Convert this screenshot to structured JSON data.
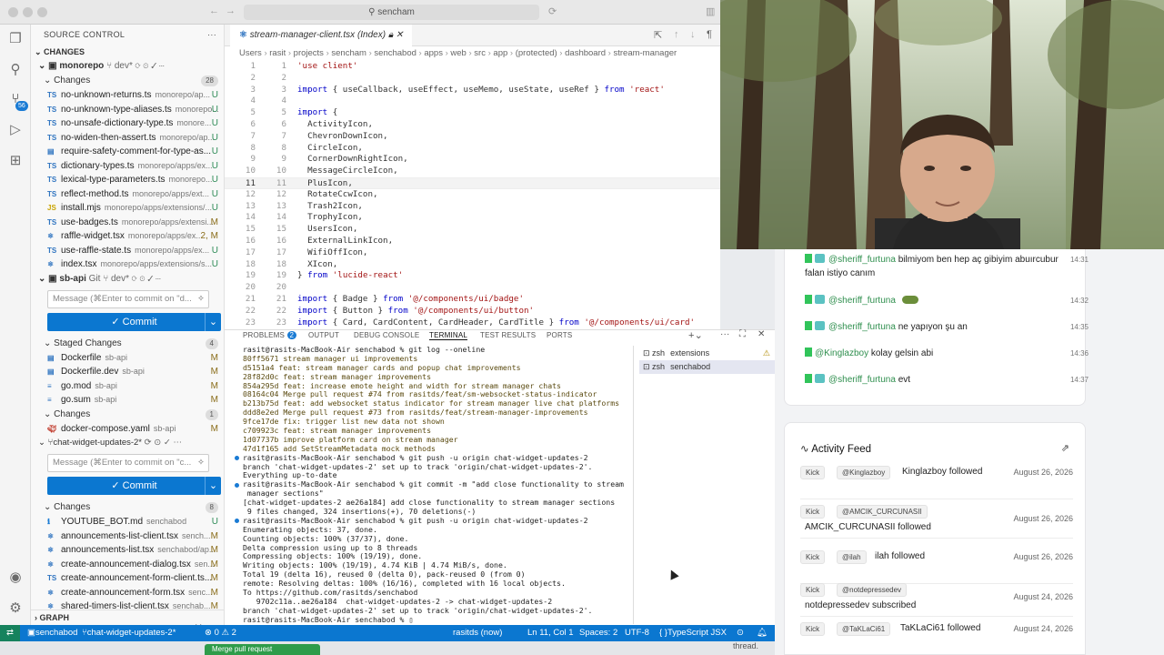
{
  "titlebar": {
    "search": "sencham"
  },
  "activitybar": {
    "scm_badge": "56"
  },
  "sidebar": {
    "title": "SOURCE CONTROL",
    "changes_header": "CHANGES",
    "repo1": {
      "name": "monorepo",
      "branch": "dev*"
    },
    "repo1_changes_label": "Changes",
    "repo1_changes_count": "28",
    "repo1_files": [
      {
        "name": "no-unknown-returns.ts",
        "dir": "monorepo/ap...",
        "status": "U"
      },
      {
        "name": "no-unknown-type-aliases.ts",
        "dir": "monorepo...",
        "status": "U"
      },
      {
        "name": "no-unsafe-dictionary-type.ts",
        "dir": "monore...",
        "status": "U"
      },
      {
        "name": "no-widen-then-assert.ts",
        "dir": "monorepo/ap...",
        "status": "U"
      },
      {
        "name": "require-safety-comment-for-type-as...",
        "dir": "",
        "status": "U"
      },
      {
        "name": "dictionary-types.ts",
        "dir": "monorepo/apps/ex...",
        "status": "U"
      },
      {
        "name": "lexical-type-parameters.ts",
        "dir": "monorepo...",
        "status": "U"
      },
      {
        "name": "reflect-method.ts",
        "dir": "monorepo/apps/ext...",
        "status": "U"
      },
      {
        "name": "install.mjs",
        "dir": "monorepo/apps/extensions/...",
        "status": "U"
      },
      {
        "name": "use-badges.ts",
        "dir": "monorepo/apps/extensi...",
        "status": "M"
      },
      {
        "name": "raffle-widget.tsx",
        "dir": "monorepo/apps/ex...",
        "status": "2, M"
      },
      {
        "name": "use-raffle-state.ts",
        "dir": "monorepo/apps/ex...",
        "status": "U"
      },
      {
        "name": "index.tsx",
        "dir": "monorepo/apps/extensions/s...",
        "status": "U"
      }
    ],
    "repo2": {
      "name": "sb-api",
      "vcs": "Git",
      "branch": "dev*"
    },
    "repo2_msg_placeholder": "Message (⌘Enter to commit on \"d...",
    "commit_label": "✓ Commit",
    "staged_label": "Staged Changes",
    "staged_count": "4",
    "staged_files": [
      {
        "name": "Dockerfile",
        "dir": "sb-api",
        "status": "M"
      },
      {
        "name": "Dockerfile.dev",
        "dir": "sb-api",
        "status": "M"
      },
      {
        "name": "go.mod",
        "dir": "sb-api",
        "status": "M"
      },
      {
        "name": "go.sum",
        "dir": "sb-api",
        "status": "M"
      }
    ],
    "repo2_changes_label": "Changes",
    "repo2_changes_count": "1",
    "repo2_files": [
      {
        "name": "docker-compose.yaml",
        "dir": "sb-api",
        "status": "M"
      }
    ],
    "repo3": {
      "branch": "chat-widget-updates-2*"
    },
    "repo3_msg_placeholder": "Message (⌘Enter to commit on \"c...",
    "repo3_changes_label": "Changes",
    "repo3_changes_count": "8",
    "repo3_files": [
      {
        "name": "YOUTUBE_BOT.md",
        "dir": "senchabod",
        "status": "U"
      },
      {
        "name": "announcements-list-client.tsx",
        "dir": "sench...",
        "status": "M"
      },
      {
        "name": "announcements-list.tsx",
        "dir": "senchabod/ap...",
        "status": "M"
      },
      {
        "name": "create-announcement-dialog.tsx",
        "dir": "sen...",
        "status": "M"
      },
      {
        "name": "create-announcement-form-client.ts...",
        "dir": "",
        "status": "M"
      },
      {
        "name": "create-announcement-form.tsx",
        "dir": "senc...",
        "status": "M"
      },
      {
        "name": "shared-timers-list-client.tsx",
        "dir": "senchab...",
        "status": "M"
      },
      {
        "name": "shared-timers-list.tsx",
        "dir": "senchabod/app...",
        "status": "M"
      }
    ],
    "graph_label": "GRAPH"
  },
  "editor": {
    "tab": "stream-manager-client.tsx (Index)",
    "breadcrumb": [
      "Users",
      "rasit",
      "projects",
      "sencham",
      "senchabod",
      "apps",
      "web",
      "src",
      "app",
      "(protected)",
      "dashboard",
      "stream-manager"
    ],
    "lines": [
      "'use client'",
      "",
      "import { useCallback, useEffect, useMemo, useState, useRef } from 'react'",
      "",
      "import {",
      "  ActivityIcon,",
      "  ChevronDownIcon,",
      "  CircleIcon,",
      "  CornerDownRightIcon,",
      "  MessageCircleIcon,",
      "  PlusIcon,",
      "  RotateCcwIcon,",
      "  Trash2Icon,",
      "  TrophyIcon,",
      "  UsersIcon,",
      "  ExternalLinkIcon,",
      "  WifiOffIcon,",
      "  XIcon,",
      "} from 'lucide-react'",
      "",
      "import { Badge } from '@/components/ui/badge'",
      "import { Button } from '@/components/ui/button'",
      "import { Card, CardContent, CardHeader, CardTitle } from '@/components/ui/card'"
    ]
  },
  "panel": {
    "tabs": {
      "problems": "PROBLEMS",
      "problems_count": "2",
      "output": "OUTPUT",
      "debug": "DEBUG CONSOLE",
      "terminal": "TERMINAL",
      "test": "TEST RESULTS",
      "ports": "PORTS"
    },
    "terminal_lines": [
      "rasit@rasits-MacBook-Air senchabod % git log --oneline",
      "80ff5671 stream manager ui improvements",
      "d5151a4 feat: stream manager cards and popup chat improvements",
      "28f82d0c feat: stream manager improvements",
      "854a295d feat: increase emote height and width for stream manager chats",
      "08164c04 Merge pull request #74 from rasitds/feat/sm-websocket-status-indicator",
      "b213b75d feat: add websocket status indicator for stream manager live chat platforms",
      "ddd8e2ed Merge pull request #73 from rasitds/feat/stream-manager-improvements",
      "9fce17de fix: trigger list new data not shown",
      "c709923c feat: stream manager improvements",
      "1d07737b improve platform card on stream manager",
      "47d1f165 add SetStreamMetadata mock methods",
      "rasit@rasits-MacBook-Air senchabod % git push -u origin chat-widget-updates-2",
      "branch 'chat-widget-updates-2' set up to track 'origin/chat-widget-updates-2'.",
      "Everything up-to-date",
      "rasit@rasits-MacBook-Air senchabod % git commit -m \"add close functionality to stream",
      " manager sections\"",
      "[chat-widget-updates-2 ae26a184] add close functionality to stream manager sections",
      " 9 files changed, 324 insertions(+), 70 deletions(-)",
      "rasit@rasits-MacBook-Air senchabod % git push -u origin chat-widget-updates-2",
      "Enumerating objects: 37, done.",
      "Counting objects: 100% (37/37), done.",
      "Delta compression using up to 8 threads",
      "Compressing objects: 100% (19/19), done.",
      "Writing objects: 100% (19/19), 4.74 KiB | 4.74 MiB/s, done.",
      "Total 19 (delta 16), reused 0 (delta 0), pack-reused 0 (from 0)",
      "remote: Resolving deltas: 100% (16/16), completed with 16 local objects.",
      "To https://github.com/rasitds/senchabod",
      "   9702c11a..ae26a184  chat-widget-updates-2 -> chat-widget-updates-2",
      "branch 'chat-widget-updates-2' set up to track 'origin/chat-widget-updates-2'.",
      "rasit@rasits-MacBook-Air senchabod % "
    ],
    "term_list": [
      {
        "shell": "zsh",
        "name": "extensions"
      },
      {
        "shell": "zsh",
        "name": "senchabod"
      }
    ]
  },
  "statusbar": {
    "repo": "senchabod",
    "branch": "chat-widget-updates-2*",
    "problems": "⊗ 0 ⚠ 2",
    "author": "rasitds (now)",
    "position": "Ln 11, Col 1",
    "spaces": "Spaces: 2",
    "encoding": "UTF-8",
    "language": "TypeScript JSX"
  },
  "chat": [
    {
      "user": "@sheriff_furtuna",
      "text": "bilmiyom ben hep aç gibiyim abuırcubur falan istiyo canım",
      "time": "14:31",
      "emote": true
    },
    {
      "user": "@sheriff_furtuna",
      "text": "",
      "time": "14:32",
      "emote": true,
      "sticker": true
    },
    {
      "user": "@sheriff_furtuna",
      "text": "ne yapıyon şu an",
      "time": "14:35",
      "emote": true
    },
    {
      "user": "@Kinglazboy",
      "text": "kolay gelsin abi",
      "time": "14:36",
      "emote": false
    },
    {
      "user": "@sheriff_furtuna",
      "text": "evt",
      "time": "14:37",
      "emote": true
    }
  ],
  "activity": {
    "title": "Activity Feed",
    "items": [
      {
        "platform": "Kick",
        "user": "@Kinglazboy",
        "text": "Kinglazboy followed",
        "date": "August 26, 2026"
      },
      {
        "platform": "Kick",
        "user": "@AMCIK_CURCUNASII",
        "text": "AMCIK_CURCUNASII followed",
        "date": "August 26, 2026"
      },
      {
        "platform": "Kick",
        "user": "@ilah",
        "text": "ilah followed",
        "date": "August 26, 2026"
      },
      {
        "platform": "Kick",
        "user": "@notdepressedev",
        "text": "notdepressedev subscribed",
        "date": "August 24, 2026"
      },
      {
        "platform": "Kick",
        "user": "@TaKLaCi61",
        "text": "TaKLaCi61 followed",
        "date": "August 24, 2026"
      }
    ]
  },
  "bottom": {
    "button": "Merge pull request",
    "thread": "thread."
  }
}
